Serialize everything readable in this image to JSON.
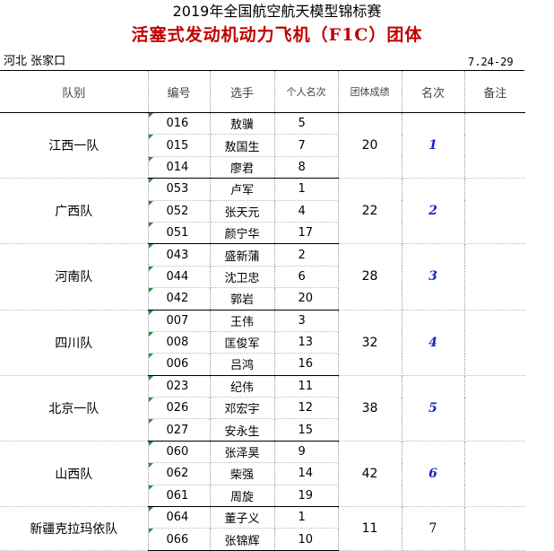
{
  "header": {
    "title": "2019年全国航空航天模型锦标赛",
    "subtitle": "活塞式发动机动力飞机（F1C）团体",
    "location": "河北 张家口",
    "date": "7.24-29"
  },
  "columns": [
    "队别",
    "编号",
    "选手",
    "个人名次",
    "团体成绩",
    "名次",
    "备注"
  ],
  "teams": [
    {
      "team": "江西一队",
      "score": "20",
      "place": "1",
      "members": [
        {
          "num": "016",
          "name": "敖骥",
          "rank": "5"
        },
        {
          "num": "015",
          "name": "敖国生",
          "rank": "7"
        },
        {
          "num": "014",
          "name": "廖君",
          "rank": "8"
        }
      ]
    },
    {
      "team": "广西队",
      "score": "22",
      "place": "2",
      "members": [
        {
          "num": "053",
          "name": "卢军",
          "rank": "1"
        },
        {
          "num": "052",
          "name": "张天元",
          "rank": "4"
        },
        {
          "num": "051",
          "name": "颜宁华",
          "rank": "17"
        }
      ]
    },
    {
      "team": "河南队",
      "score": "28",
      "place": "3",
      "members": [
        {
          "num": "043",
          "name": "盛新蒲",
          "rank": "2"
        },
        {
          "num": "044",
          "name": "沈卫忠",
          "rank": "6"
        },
        {
          "num": "042",
          "name": "郭岩",
          "rank": "20"
        }
      ]
    },
    {
      "team": "四川队",
      "score": "32",
      "place": "4",
      "members": [
        {
          "num": "007",
          "name": "王伟",
          "rank": "3"
        },
        {
          "num": "008",
          "name": "匡俊军",
          "rank": "13"
        },
        {
          "num": "006",
          "name": "吕鸿",
          "rank": "16"
        }
      ]
    },
    {
      "team": "北京一队",
      "score": "38",
      "place": "5",
      "members": [
        {
          "num": "023",
          "name": "纪伟",
          "rank": "11"
        },
        {
          "num": "026",
          "name": "邓宏宇",
          "rank": "12"
        },
        {
          "num": "027",
          "name": "安永生",
          "rank": "15"
        }
      ]
    },
    {
      "team": "山西队",
      "score": "42",
      "place": "6",
      "members": [
        {
          "num": "060",
          "name": "张泽昊",
          "rank": "9"
        },
        {
          "num": "062",
          "name": "柴强",
          "rank": "14"
        },
        {
          "num": "061",
          "name": "周旋",
          "rank": "19"
        }
      ]
    },
    {
      "team": "新疆克拉玛依队",
      "score": "11",
      "place": "7",
      "members": [
        {
          "num": "064",
          "name": "董子义",
          "rank": "1"
        },
        {
          "num": "066",
          "name": "张锦辉",
          "rank": "10"
        }
      ]
    }
  ],
  "colors": {
    "title_red": "#c00000",
    "place_blue": "#1a22cc",
    "cell_marker_green": "#1f8f2f"
  }
}
